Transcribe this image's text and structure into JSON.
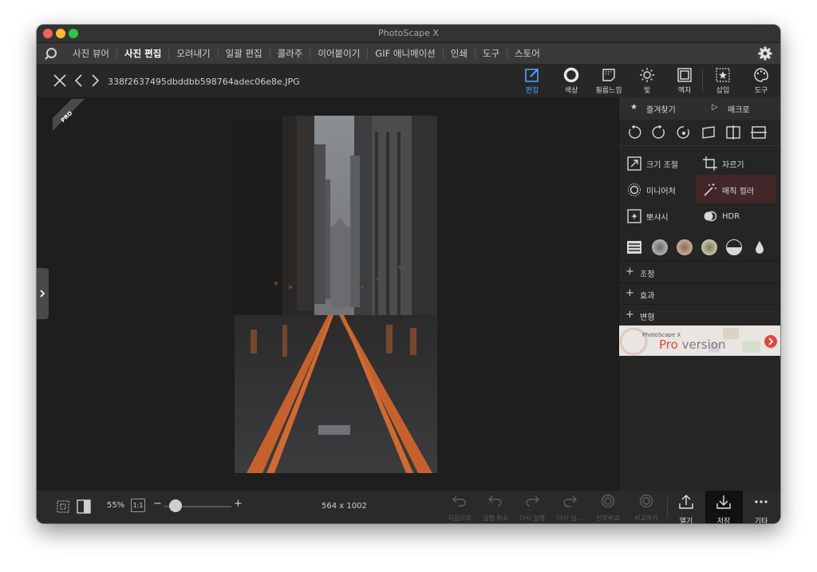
{
  "window": {
    "title": "PhotoScape X"
  },
  "menu": {
    "items": [
      {
        "label": "사진 뷰어",
        "active": false
      },
      {
        "label": "사진 편집",
        "active": true
      },
      {
        "label": "오려내기",
        "active": false
      },
      {
        "label": "일괄 편집",
        "active": false
      },
      {
        "label": "콜라주",
        "active": false
      },
      {
        "label": "이어붙이기",
        "active": false
      },
      {
        "label": "GIF 애니메이션",
        "active": false
      },
      {
        "label": "인쇄",
        "active": false
      },
      {
        "label": "도구",
        "active": false
      },
      {
        "label": "스토어",
        "active": false
      }
    ]
  },
  "toolbar": {
    "filename": "338f2637495dbddbb598764adec06e8e.JPG",
    "tools": [
      {
        "label": "편집",
        "icon": "edit-icon",
        "active": true
      },
      {
        "label": "색상",
        "icon": "color-circle-icon"
      },
      {
        "label": "필름느낌",
        "icon": "film-icon"
      },
      {
        "label": "빛",
        "icon": "sun-icon"
      },
      {
        "label": "액자",
        "icon": "frame-icon"
      },
      {
        "label": "삽입",
        "icon": "insert-icon"
      },
      {
        "label": "도구",
        "icon": "palette-icon"
      }
    ]
  },
  "canvas": {
    "pro_badge": "PRO"
  },
  "panel": {
    "favorites": "즐겨찾기",
    "macro": "매크로",
    "features": [
      {
        "label": "크기 조절",
        "icon": "resize-icon"
      },
      {
        "label": "자르기",
        "icon": "crop-icon"
      },
      {
        "label": "미니어처",
        "icon": "miniature-icon"
      },
      {
        "label": "매직 컬러",
        "icon": "magic-wand-icon"
      },
      {
        "label": "뽀샤시",
        "icon": "bloom-icon"
      },
      {
        "label": "HDR",
        "icon": "hdr-icon"
      }
    ],
    "sections": [
      "조정",
      "효과",
      "변형"
    ],
    "ad": {
      "small": "PhotoScape X",
      "pro": "Pro",
      "rest": " version"
    }
  },
  "bottom": {
    "zoom": "55%",
    "one_to_one": "1:1",
    "dimensions": "564 x 1002",
    "actions": [
      "처음으로",
      "실행 취소",
      "다시 실행",
      "다시 실...",
      "전후비교",
      "비교하기"
    ],
    "open": "열기",
    "save": "저장",
    "more": "기타"
  },
  "colors": {
    "accent": "#4aa3ff",
    "ad_red": "#e0473a"
  }
}
